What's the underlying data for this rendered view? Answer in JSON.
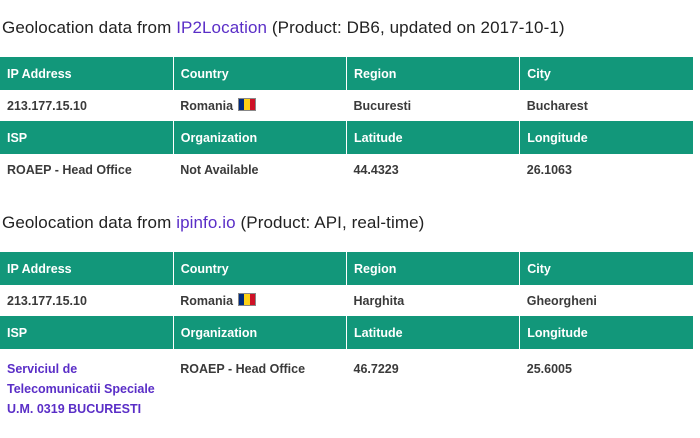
{
  "section1": {
    "heading_prefix": "Geolocation data from ",
    "heading_link": "IP2Location",
    "heading_suffix": " (Product: DB6, updated on 2017-10-1)",
    "headers_row1": [
      "IP Address",
      "Country",
      "Region",
      "City"
    ],
    "values_row1": {
      "ip": "213.177.15.10",
      "country": "Romania",
      "region": "Bucuresti",
      "city": "Bucharest"
    },
    "headers_row2": [
      "ISP",
      "Organization",
      "Latitude",
      "Longitude"
    ],
    "values_row2": {
      "isp": "ROAEP - Head Office",
      "organization": "Not Available",
      "latitude": "44.4323",
      "longitude": "26.1063"
    }
  },
  "section2": {
    "heading_prefix": "Geolocation data from ",
    "heading_link": "ipinfo.io",
    "heading_suffix": " (Product: API, real-time)",
    "headers_row1": [
      "IP Address",
      "Country",
      "Region",
      "City"
    ],
    "values_row1": {
      "ip": "213.177.15.10",
      "country": "Romania",
      "region": "Harghita",
      "city": "Gheorgheni"
    },
    "headers_row2": [
      "ISP",
      "Organization",
      "Latitude",
      "Longitude"
    ],
    "values_row2": {
      "isp": "Serviciul de Telecomunicatii Speciale U.M. 0319 BUCURESTI",
      "organization": "ROAEP - Head Office",
      "latitude": "46.7229",
      "longitude": "25.6005"
    }
  },
  "colors": {
    "header_bg": "#12977a",
    "link": "#5a2ec7",
    "flag": [
      "#002b7f",
      "#fcd116",
      "#ce1126"
    ]
  },
  "icons": {
    "country_flag": "romania-flag-icon"
  }
}
